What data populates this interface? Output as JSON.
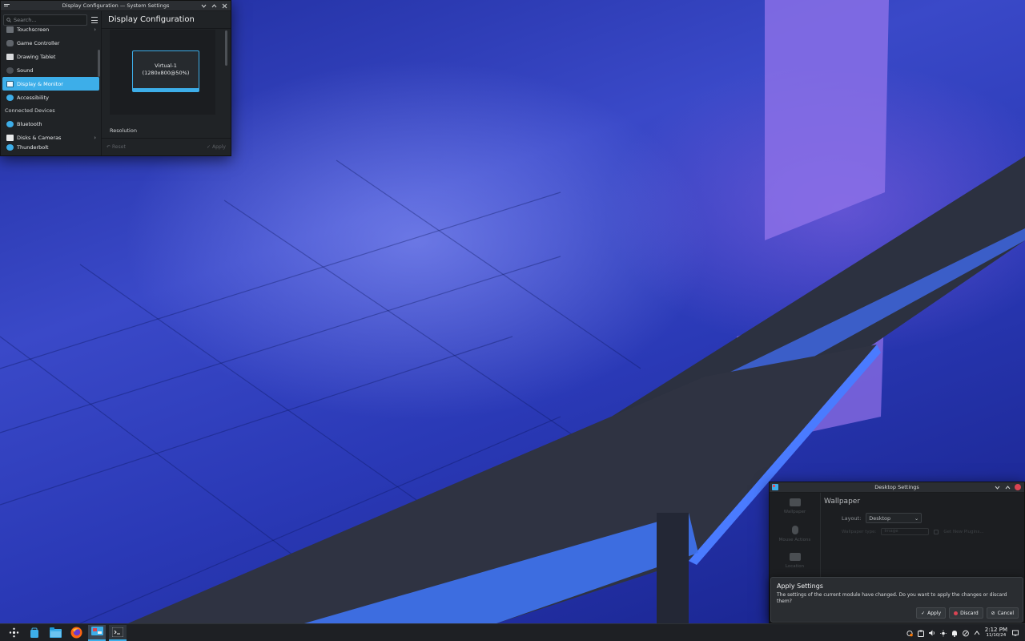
{
  "settings_window": {
    "title": "Display Configuration — System Settings",
    "search_placeholder": "Search...",
    "sidebar_items": [
      {
        "label": "Touchscreen",
        "icon": "touchscreen-icon",
        "chevron": true,
        "selected": false
      },
      {
        "label": "Game Controller",
        "icon": "game-controller-icon",
        "chevron": false,
        "selected": false
      },
      {
        "label": "Drawing Tablet",
        "icon": "drawing-tablet-icon",
        "chevron": false,
        "selected": false
      },
      {
        "label": "Sound",
        "icon": "sound-icon",
        "chevron": false,
        "selected": false
      },
      {
        "label": "Display & Monitor",
        "icon": "display-icon",
        "chevron": false,
        "selected": true
      },
      {
        "label": "Accessibility",
        "icon": "accessibility-icon",
        "chevron": false,
        "selected": false
      }
    ],
    "section_connected_devices": "Connected Devices",
    "connected_items": [
      {
        "label": "Bluetooth",
        "icon": "bluetooth-icon",
        "chevron": false
      },
      {
        "label": "Disks & Cameras",
        "icon": "disks-icon",
        "chevron": true
      },
      {
        "label": "Thunderbolt",
        "icon": "thunderbolt-icon",
        "chevron": false
      }
    ],
    "page_title": "Display Configuration",
    "monitor_name": "Virtual-1",
    "monitor_mode": "(1280x800@50%)",
    "resolution_label": "Resolution",
    "reset_label": "Reset",
    "apply_label": "Apply"
  },
  "desktop_window": {
    "title": "Desktop Settings",
    "side_items": [
      "Wallpaper",
      "Mouse Actions",
      "Location"
    ],
    "section_title": "Wallpaper",
    "layout_label": "Layout:",
    "layout_value": "Desktop",
    "wallpaper_type_label": "Wallpaper type:",
    "wallpaper_type_value": "Image",
    "get_new_plugins": "Get New Plugins..."
  },
  "apply_dialog": {
    "title": "Apply Settings",
    "message": "The settings of the current module have changed. Do you want to apply the changes or discard them?",
    "apply": "Apply",
    "discard": "Discard",
    "cancel": "Cancel"
  },
  "taskbar": {
    "apps": [
      "application-launcher-icon",
      "discover-icon",
      "dolphin-icon",
      "firefox-icon",
      "system-settings-icon",
      "terminal-icon"
    ],
    "time": "2:12 PM",
    "date": "11/10/24"
  },
  "colors": {
    "accent": "#3daee9",
    "close_red": "#da4453",
    "window_bg": "#202326"
  }
}
